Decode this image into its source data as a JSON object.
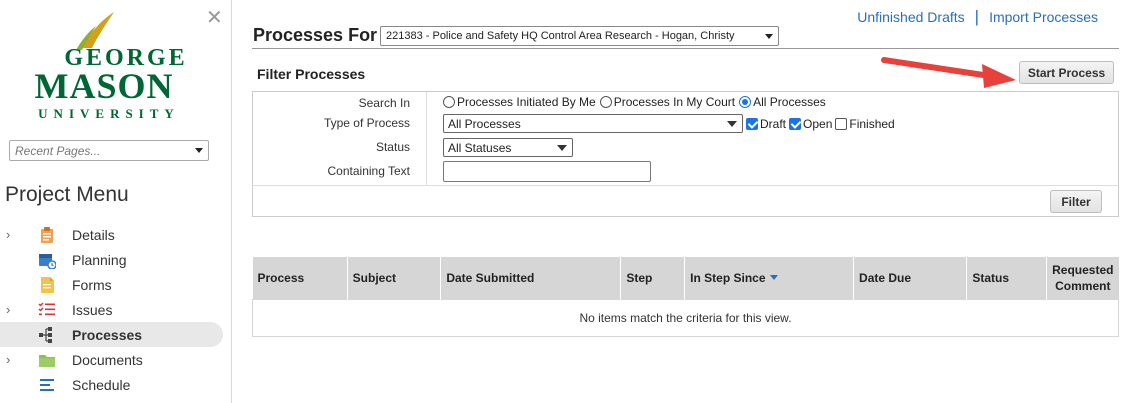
{
  "sidebar": {
    "logo": {
      "line1": "GEORGE",
      "line2": "MASON",
      "line3": "UNIVERSITY",
      "color": "#006633",
      "accent": "#d4a017"
    },
    "recent_pages_placeholder": "Recent Pages...",
    "menu_title": "Project Menu",
    "items": [
      {
        "label": "Details",
        "icon": "clipboard-icon",
        "expandable": true,
        "active": false
      },
      {
        "label": "Planning",
        "icon": "calendar-icon",
        "expandable": false,
        "active": false
      },
      {
        "label": "Forms",
        "icon": "form-icon",
        "expandable": false,
        "active": false
      },
      {
        "label": "Issues",
        "icon": "checklist-icon",
        "expandable": true,
        "active": false
      },
      {
        "label": "Processes",
        "icon": "process-icon",
        "expandable": false,
        "active": true
      },
      {
        "label": "Documents",
        "icon": "folder-icon",
        "expandable": true,
        "active": false
      },
      {
        "label": "Schedule",
        "icon": "schedule-icon",
        "expandable": false,
        "active": false
      }
    ]
  },
  "header": {
    "links": [
      "Unfinished Drafts",
      "Import Processes"
    ],
    "title": "Processes For",
    "project_selected": "221383 - Police and Safety HQ Control Area Research - Hogan, Christy"
  },
  "filter": {
    "title": "Filter Processes",
    "start_button": "Start Process",
    "labels": {
      "search_in": "Search In",
      "type": "Type of Process",
      "status": "Status",
      "text": "Containing Text"
    },
    "search_in_options": [
      {
        "label": "Processes Initiated By Me",
        "checked": false
      },
      {
        "label": "Processes In My Court",
        "checked": false
      },
      {
        "label": "All Processes",
        "checked": true
      }
    ],
    "type_selected": "All Processes",
    "type_checkboxes": [
      {
        "label": "Draft",
        "checked": true
      },
      {
        "label": "Open",
        "checked": true
      },
      {
        "label": "Finished",
        "checked": false
      }
    ],
    "status_selected": "All Statuses",
    "text_value": "",
    "filter_button": "Filter"
  },
  "results": {
    "columns": [
      "Process",
      "Subject",
      "Date Submitted",
      "Step",
      "In Step Since",
      "Date Due",
      "Status",
      "Requested Comment"
    ],
    "sorted_column": "In Step Since",
    "empty_message": "No items match the criteria for this view."
  },
  "colors": {
    "link": "#2a6ebb",
    "accent_arrow": "#e8403a",
    "check": "#1a73e8"
  }
}
